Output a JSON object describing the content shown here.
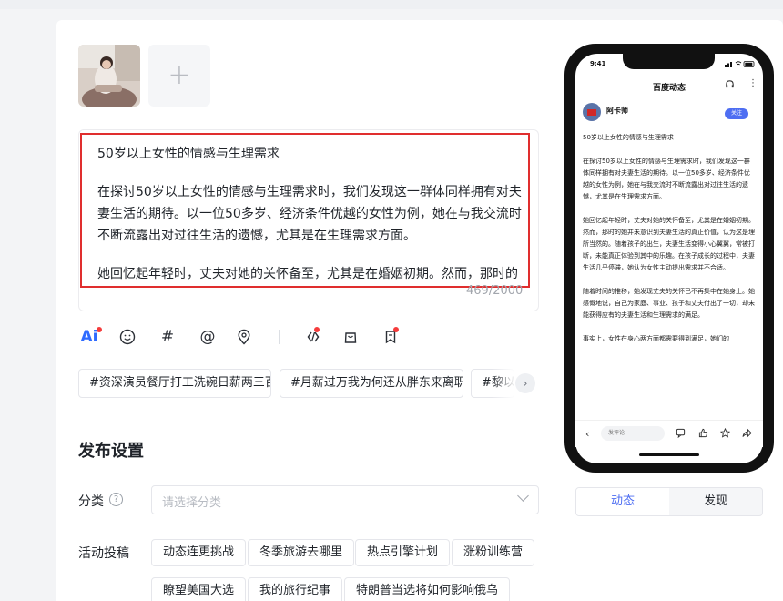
{
  "editor": {
    "paragraphs": [
      "50岁以上女性的情感与生理需求",
      "在探讨50岁以上女性的情感与生理需求时，我们发现这一群体同样拥有对夫妻生活的期待。以一位50多岁、经济条件优越的女性为例，她在与我交流时不断流露出对过往生活的遗憾，尤其是在生理需求方面。",
      "她回忆起年轻时，丈夫对她的关怀备至，尤其是在婚姻初期。然而，那时的"
    ],
    "char_count": "469/2000"
  },
  "toolbar": {
    "ai_label": "Ai",
    "hash_label": "#",
    "at_label": "@"
  },
  "hashtags": [
    "#资深演员餐厅打工洗碗日薪两三百",
    "#月薪过万我为何还从胖东来离职",
    "#黎以"
  ],
  "publish": {
    "title": "发布设置",
    "category_label": "分类",
    "category_placeholder": "请选择分类",
    "activity_label": "活动投稿",
    "activities": [
      "动态连更挑战",
      "冬季旅游去哪里",
      "热点引擎计划",
      "涨粉训练营",
      "瞭望美国大选",
      "我的旅行纪事",
      "特朗普当选将如何影响俄乌"
    ]
  },
  "phone": {
    "time": "9:41",
    "title": "百度动态",
    "author": "阿卡师",
    "follow": "关注",
    "comment_placeholder": "发评论",
    "body": [
      "50岁以上女性的情感与生理需求",
      "在探讨50岁以上女性的情感与生理需求时，我们发现这一群体同样拥有对夫妻生活的期待。以一位50多岁、经济条件优越的女性为例，她在与我交流时不断流露出对过往生活的遗憾，尤其是在生理需求方面。",
      "她回忆起年轻时，丈夫对她的关怀备至，尤其是在婚姻初期。然而，那时的她并未意识到夫妻生活的真正价值，认为这是理所当然的。随着孩子的出生，夫妻生活变得小心翼翼，常被打断，未能真正体验到其中的乐趣。在孩子成长的过程中，夫妻生活几乎停滞，她认为女性主动提出需求并不合适。",
      "随着时间的推移，她发现丈夫的关怀已不再集中在她身上。她感慨地说，自己为家庭、事业、孩子和丈夫付出了一切，却未能获得应有的夫妻生活和生理需求的满足。",
      "事实上，女性在身心两方面都需要得到满足，她们的"
    ]
  },
  "preview_tabs": [
    "动态",
    "发现"
  ]
}
